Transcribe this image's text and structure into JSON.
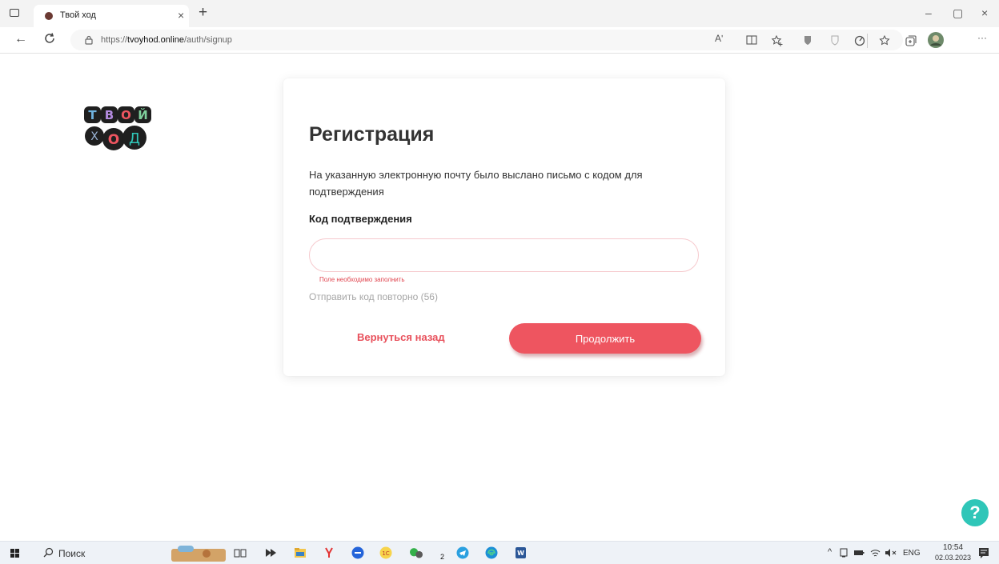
{
  "browser": {
    "tab_title": "Твой ход",
    "tab_close": "×",
    "new_tab": "+",
    "window_controls": {
      "minimize": "–",
      "restore": "▢",
      "close": "×"
    },
    "url_prefix": "https://",
    "url_domain": "tvoyhod.online",
    "url_path": "/auth/signup",
    "read_aloud": "Aʹ",
    "more": "···"
  },
  "logo": {
    "line1": [
      "Т",
      "В",
      "О",
      "Й"
    ],
    "line2": [
      "Х",
      "О",
      "Д"
    ]
  },
  "form": {
    "title": "Регистрация",
    "description": "На указанную электронную почту было выслано письмо с кодом для подтверждения",
    "code_label": "Код подтверждения",
    "code_value": "",
    "code_placeholder": "",
    "error": "Поле необходимо заполнить",
    "resend": "Отправить код повторно (56)",
    "back": "Вернуться назад",
    "continue": "Продолжить"
  },
  "help": "?",
  "taskbar": {
    "search_label": "Поиск",
    "badge": "2",
    "language": "ENG",
    "time": "10:54",
    "date": "02.03.2023"
  },
  "colors": {
    "accent": "#ee5560",
    "error": "#e0454f",
    "help": "#2fc6b8"
  },
  "icons": [
    "read-aloud-icon",
    "immersive-reader-icon",
    "favorites-add-icon",
    "extension-icon",
    "shield-icon",
    "performance-icon",
    "favorites-icon",
    "collections-icon",
    "profile-avatar",
    "more-icon"
  ]
}
